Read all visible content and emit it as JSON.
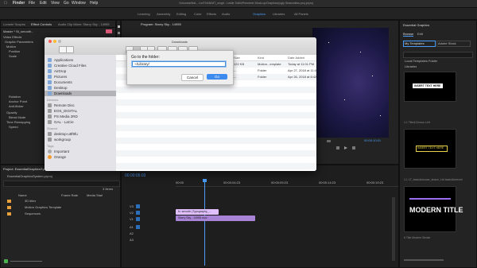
{
  "menubar": {
    "apple": "",
    "items": [
      "Finder",
      "File",
      "Edit",
      "View",
      "Go",
      "Window",
      "Help"
    ],
    "window_title": "/Volumes/Mat... Lin/THAN/MT_mogrt - Leslie TuttN/Premiere/ Mock-up/Graphics/(ugly Seasonless.proj.prproj"
  },
  "workspace_tabs": [
    {
      "label": "Learning",
      "active": false
    },
    {
      "label": "Assembly",
      "active": false
    },
    {
      "label": "Editing",
      "active": false
    },
    {
      "label": "Color",
      "active": false
    },
    {
      "label": "Effects",
      "active": false
    },
    {
      "label": "Audio",
      "active": false
    },
    {
      "label": "Graphics",
      "active": true
    },
    {
      "label": "Libraries",
      "active": false
    },
    {
      "label": "All Panels",
      "active": false
    }
  ],
  "effect_controls": {
    "tabs": [
      "Lumetri Scopes",
      "Effect Controls",
      "Audio Clip Mixer: Starry Sky - 14955"
    ],
    "rows": [
      "Master * St_smooth...",
      "Video Effects",
      "Graphic Parameters",
      "Motion",
      "Position",
      "Scale",
      "Rotation",
      "Anchor Point",
      "Anti-flicker",
      "Opacity",
      "Blend Mode",
      "Time Remapping",
      "Speed"
    ]
  },
  "program": {
    "title": "Program: Starry Sky - 14955",
    "timecode": "00:00:10:01"
  },
  "finder": {
    "title": "Downloads",
    "sidebar_sections": [
      {
        "header": "",
        "items": [
          "Applications",
          "Creative Cloud Files",
          "AirDrop",
          "Pictures",
          "Documents",
          "Desktop",
          "Downloads"
        ]
      },
      {
        "header": "Devices",
        "items": [
          "Remote Disc",
          "EOS_DIGITAL",
          "PS Media 2RD",
          "GAL - LaCie"
        ]
      },
      {
        "header": "Shared",
        "items": [
          "desktop-u8f9fu",
          "workgroup"
        ]
      },
      {
        "header": "Tags",
        "items": [
          "Important",
          "Orange"
        ]
      }
    ],
    "selected_item": "Downloads",
    "columns": [
      "Size",
      "Kind",
      "Date Added"
    ],
    "files": [
      {
        "size": "122 KB",
        "kind": "Motion...emplate",
        "date": "Today at 11:01 PM"
      },
      {
        "size": "--",
        "kind": "Folder",
        "date": "Apr 27, 2018 at 11:00 PM"
      },
      {
        "size": "--",
        "kind": "Folder",
        "date": "Apr 26, 2018 at 6:42 PM"
      }
    ]
  },
  "goto_sheet": {
    "label": "Go to the folder:",
    "value": "~/Library/",
    "cancel_label": "Cancel",
    "go_label": "Go"
  },
  "project": {
    "tab": "Project: EssentialGraphicsSystem",
    "file": "EssentialGraphicsSystem.prproj",
    "items_count": "3 Items",
    "columns": [
      "Name",
      "Frame Rate",
      "Media Start"
    ],
    "items": [
      "3D titles",
      "Motion Graphics Template",
      "Sequences"
    ]
  },
  "timeline": {
    "timecode": "00:00:05:03",
    "ruler": [
      "00:00",
      "00:00:04:23",
      "00:00:09:23",
      "00:00:14:23",
      "00:00:19:23"
    ],
    "tracks": [
      "V3",
      "V2",
      "V1",
      "A1",
      "A2",
      "A3"
    ],
    "clips": [
      {
        "label": "fx: smooth (Typography_...",
        "track": "V2"
      },
      {
        "label": "Starry Sky - 14955.mov",
        "track": "V1"
      }
    ]
  },
  "essential_graphics": {
    "title": "Essential Graphics",
    "tabs": [
      "Browse",
      "Edit"
    ],
    "dropdown": "My Templates",
    "dropdown2": "Adobe Stock",
    "checks": [
      "Local Templates Folder",
      "Libraries"
    ],
    "thumbs": [
      {
        "text": "INSERT TEXT HERE",
        "caption": "1.1 Title&Chorus Left"
      },
      {
        "text": "INSERT TEXT HERE",
        "caption": "1.1 LT_basic&mouse_shave, Ltd basic&forever/"
      },
      {
        "text": "MODERN TITLE",
        "caption": "6 Title Modern Stroke"
      }
    ]
  },
  "colors": {
    "accent": "#4a9cf6",
    "clip_video": "#a883d6",
    "clip_fx": "#e0c0ff"
  }
}
